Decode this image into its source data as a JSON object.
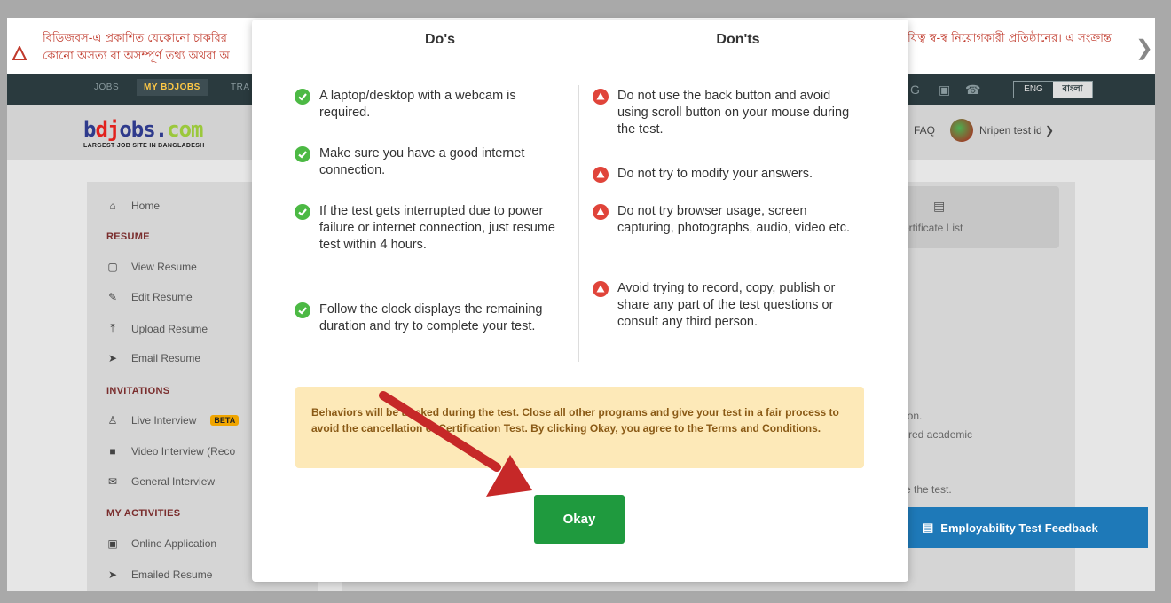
{
  "notice": {
    "left_line1": "বিডিজবস-এ প্রকাশিত যেকোনো চাকরির",
    "left_line2": "কোনো অসত্য বা অসম্পূর্ণ তথ্য অথবা অ",
    "right_line1": "যিত্ব স্ব-স্ব নিয়োগকারী প্রতিষ্ঠানের। এ সংক্রান্ত"
  },
  "topnav": {
    "items": [
      "JOBS",
      "MY BDJOBS",
      "TRA"
    ],
    "lang_en": "ENG",
    "lang_bn": "বাংলা"
  },
  "logo": {
    "b": "b",
    "dj": "dj",
    "obs": "obs.",
    "com": "com",
    "tagline": "LARGEST JOB SITE IN BANGLADESH"
  },
  "user": {
    "faq": "FAQ",
    "name": "Nripen test id"
  },
  "sidebar": {
    "home": "Home",
    "resume_head": "RESUME",
    "resume_items": [
      "View Resume",
      "Edit Resume",
      "Upload Resume",
      "Email Resume"
    ],
    "invitations_head": "INVITATIONS",
    "live_interview": "Live Interview",
    "beta": "BETA",
    "video_interview": "Video Interview (Reco",
    "general_interview": "General Interview",
    "activities_head": "MY ACTIVITIES",
    "activity_items": [
      "Online Application",
      "Emailed Resume"
    ]
  },
  "main": {
    "cert_list": "y Certificate List",
    "bg_line1": "ion.",
    "bg_line2": "rred academic",
    "bg_line3": "e the test."
  },
  "feedback": {
    "label": "Employability Test Feedback"
  },
  "modal": {
    "dos_title": "Do's",
    "donts_title": "Don'ts",
    "dos": [
      "A laptop/desktop with a webcam is required.",
      "Make sure you have a good internet connection.",
      "If the test gets interrupted due to power failure or internet connection, just resume test within 4 hours.",
      "Follow the clock displays the remaining duration and try to complete your test."
    ],
    "donts": [
      "Do not use the back button and avoid using scroll button on your mouse during the test.",
      "Do not try to modify your answers.",
      "Do not try browser usage, screen capturing, photographs, audio, video etc.",
      "Avoid trying to record, copy, publish or share any part of the test questions or consult any third person."
    ],
    "warning": "Behaviors will be tracked during the test. Close all other programs and give your test in a fair process to avoid the cancellation of Certification Test. By clicking Okay, you agree to the Terms and Conditions.",
    "okay_label": "Okay"
  },
  "colors": {
    "ok_green": "#1f9a3e",
    "dont_red": "#e0443a",
    "annotation_arrow": "#c62828"
  },
  "icons": {
    "check": "check-circle-icon",
    "warning": "warning-triangle-icon",
    "feedback": "certificate-icon"
  }
}
